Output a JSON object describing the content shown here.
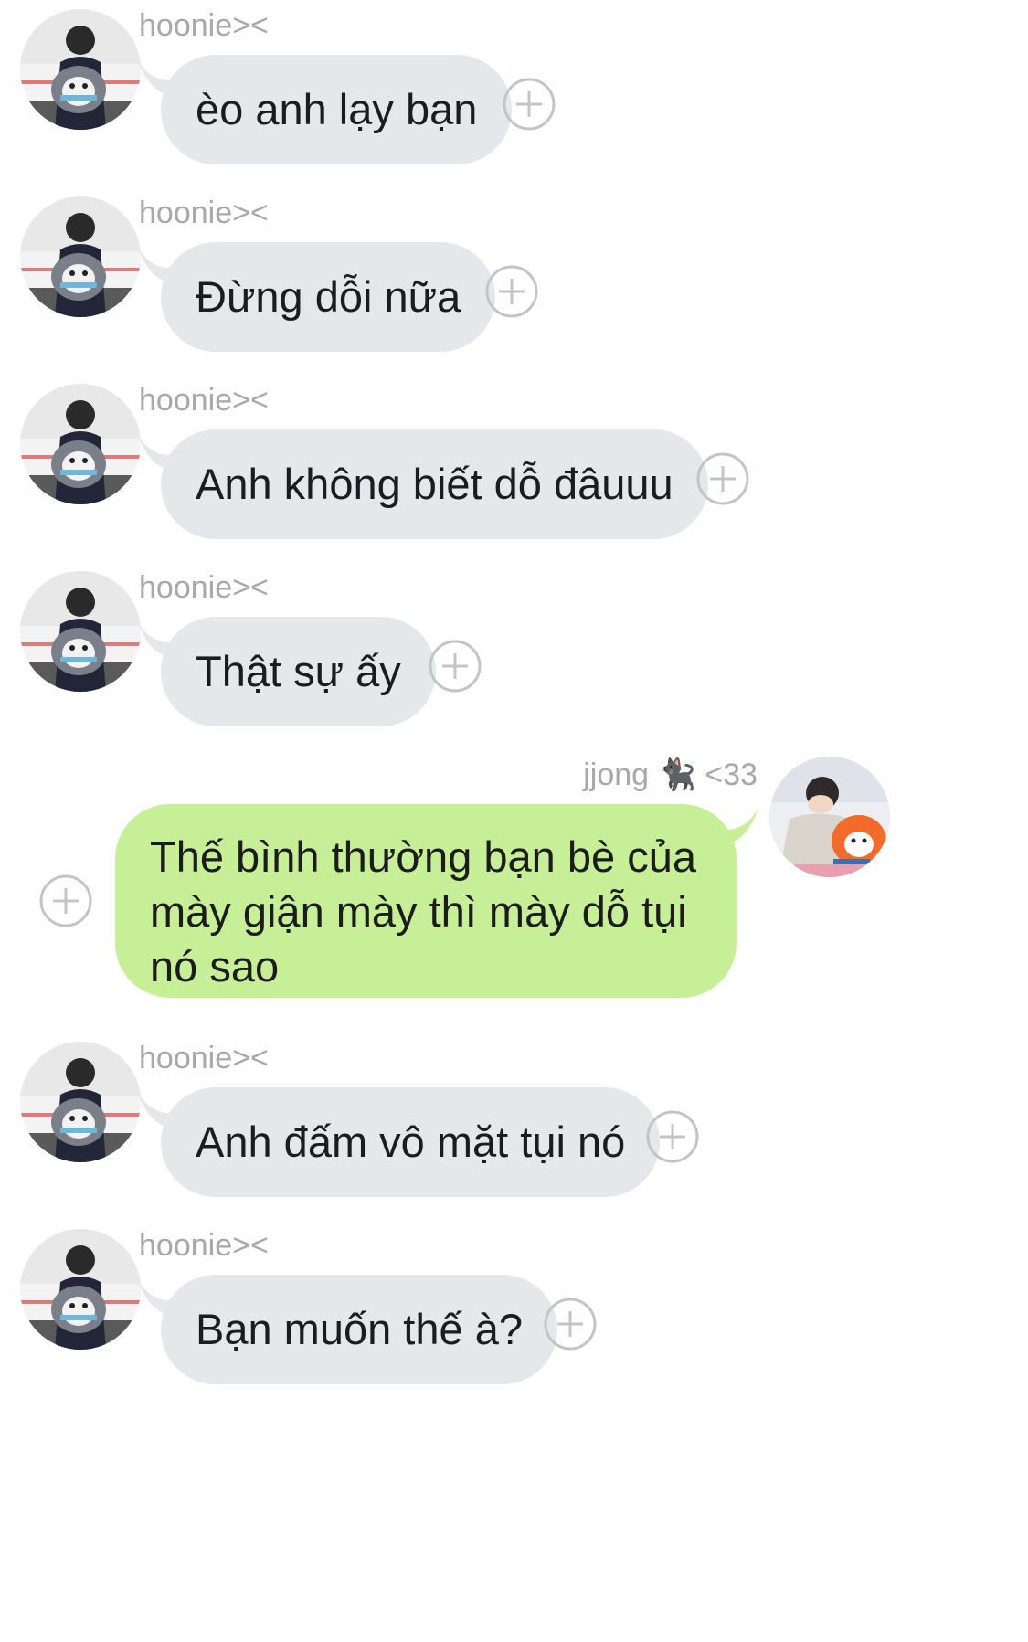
{
  "conversation": {
    "messages": [
      {
        "sender": "hoonie><",
        "text": "èo anh lạy bạn",
        "direction": "incoming"
      },
      {
        "sender": "hoonie><",
        "text": "Đừng dỗi nữa",
        "direction": "incoming"
      },
      {
        "sender": "hoonie><",
        "text": "Anh không biết dỗ đâuuu",
        "direction": "incoming"
      },
      {
        "sender": "hoonie><",
        "text": "Thật sự ấy",
        "direction": "incoming"
      },
      {
        "sender": "jjong 🐈‍⬛ <33",
        "text": "Thế bình thường bạn bè của mày giận mày thì mày dỗ tụi nó sao",
        "direction": "outgoing"
      },
      {
        "sender": "hoonie><",
        "text": "Anh đấm vô mặt tụi nó",
        "direction": "incoming"
      },
      {
        "sender": "hoonie><",
        "text": "Bạn muốn thế à?",
        "direction": "incoming"
      }
    ]
  },
  "icons": {
    "add_reaction": "plus-circle-icon",
    "incoming_avatar": "avatar-penguin-plush",
    "outgoing_avatar": "avatar-orange-plush"
  },
  "colors": {
    "incoming_bubble": "#e5e7ea",
    "outgoing_bubble": "#c6ef97",
    "sender_name": "#a8a8a8",
    "text": "#1c1c1c",
    "plus_icon": "#c4c4c4"
  }
}
